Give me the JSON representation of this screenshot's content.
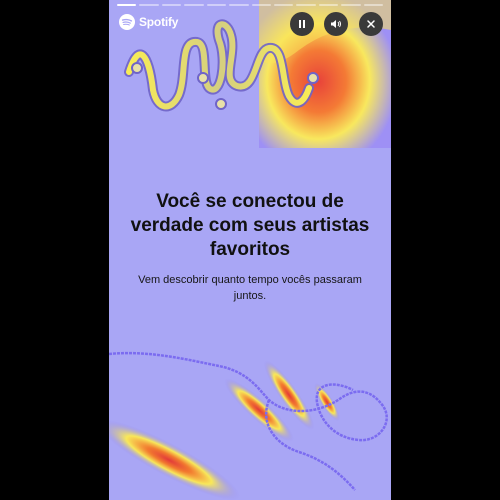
{
  "story": {
    "brand": "Spotify",
    "title": "Você se conectou de verdade com seus artistas favoritos",
    "subtitle": "Vem descobrir quanto tempo vocês passaram juntos.",
    "progress": {
      "total_segments": 12,
      "active_segments": 1
    }
  },
  "controls": {
    "pause_icon": "pause-icon",
    "volume_icon": "volume-icon",
    "close_icon": "close-icon"
  },
  "colors": {
    "background": "#a9a6f5",
    "frame": "#000000",
    "title_text": "#111111",
    "accent_yellow": "#f5f06a",
    "accent_orange": "#f2702b",
    "accent_red": "#e3343a",
    "accent_purple": "#7b6cf0"
  }
}
